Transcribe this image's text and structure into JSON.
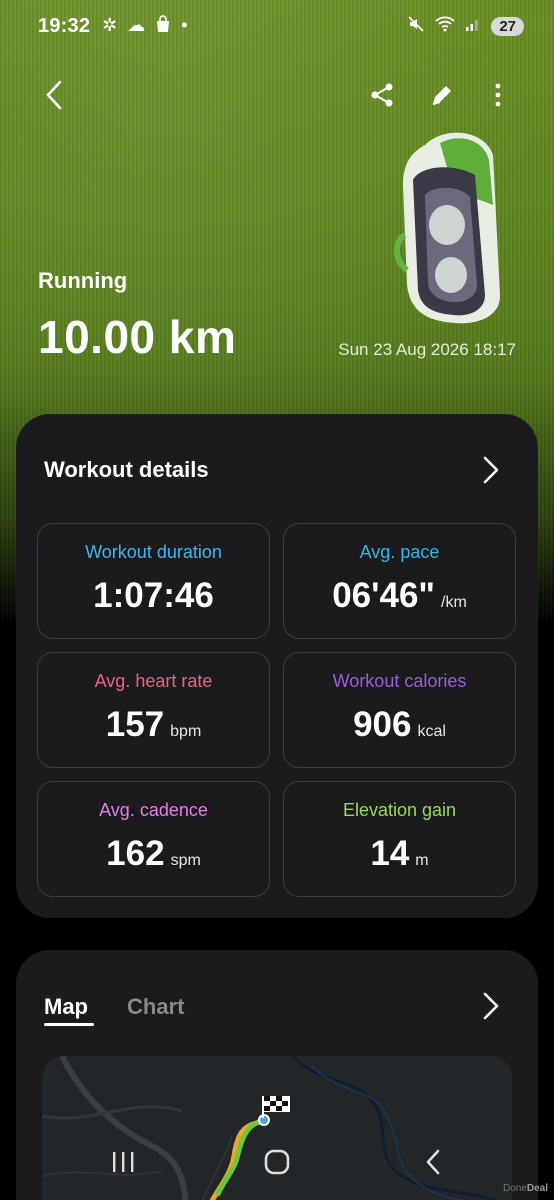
{
  "status_bar": {
    "time": "19:32",
    "left_icons": [
      "pinwheel-icon",
      "weather-icon",
      "shopping-bag-icon",
      "dot-icon"
    ],
    "right_icons": [
      "mute-icon",
      "wifi-icon",
      "signal-icon"
    ],
    "battery": "27"
  },
  "toolbar": {
    "back_icon": "chevron-left-icon",
    "share_icon": "share-icon",
    "edit_icon": "pencil-icon",
    "more_icon": "more-vertical-icon"
  },
  "activity": {
    "type": "Running",
    "distance": "10.00 km",
    "datetime": "Sun 23 Aug 2026 18:17"
  },
  "workout_details": {
    "title": "Workout details",
    "tiles": [
      {
        "label": "Workout duration",
        "value": "1:07:46",
        "unit": "",
        "color": "#3fb6f0"
      },
      {
        "label": "Avg. pace",
        "value": "06'46\"",
        "unit": "/km",
        "color": "#37b4e6"
      },
      {
        "label": "Avg. heart rate",
        "value": "157",
        "unit": "bpm",
        "color": "#f0617f"
      },
      {
        "label": "Workout calories",
        "value": "906",
        "unit": "kcal",
        "color": "#9a5fd8"
      },
      {
        "label": "Avg. cadence",
        "value": "162",
        "unit": "spm",
        "color": "#e57fe8"
      },
      {
        "label": "Elevation gain",
        "value": "14",
        "unit": "m",
        "color": "#97d95a"
      }
    ]
  },
  "map_card": {
    "tabs": [
      "Map",
      "Chart"
    ],
    "active_tab": "Map"
  },
  "nav_bar": {
    "recent_icon": "recent-apps-icon",
    "home_icon": "home-icon",
    "back_icon": "back-icon"
  },
  "watermark": {
    "part1": "Done",
    "part2": "Deal"
  }
}
